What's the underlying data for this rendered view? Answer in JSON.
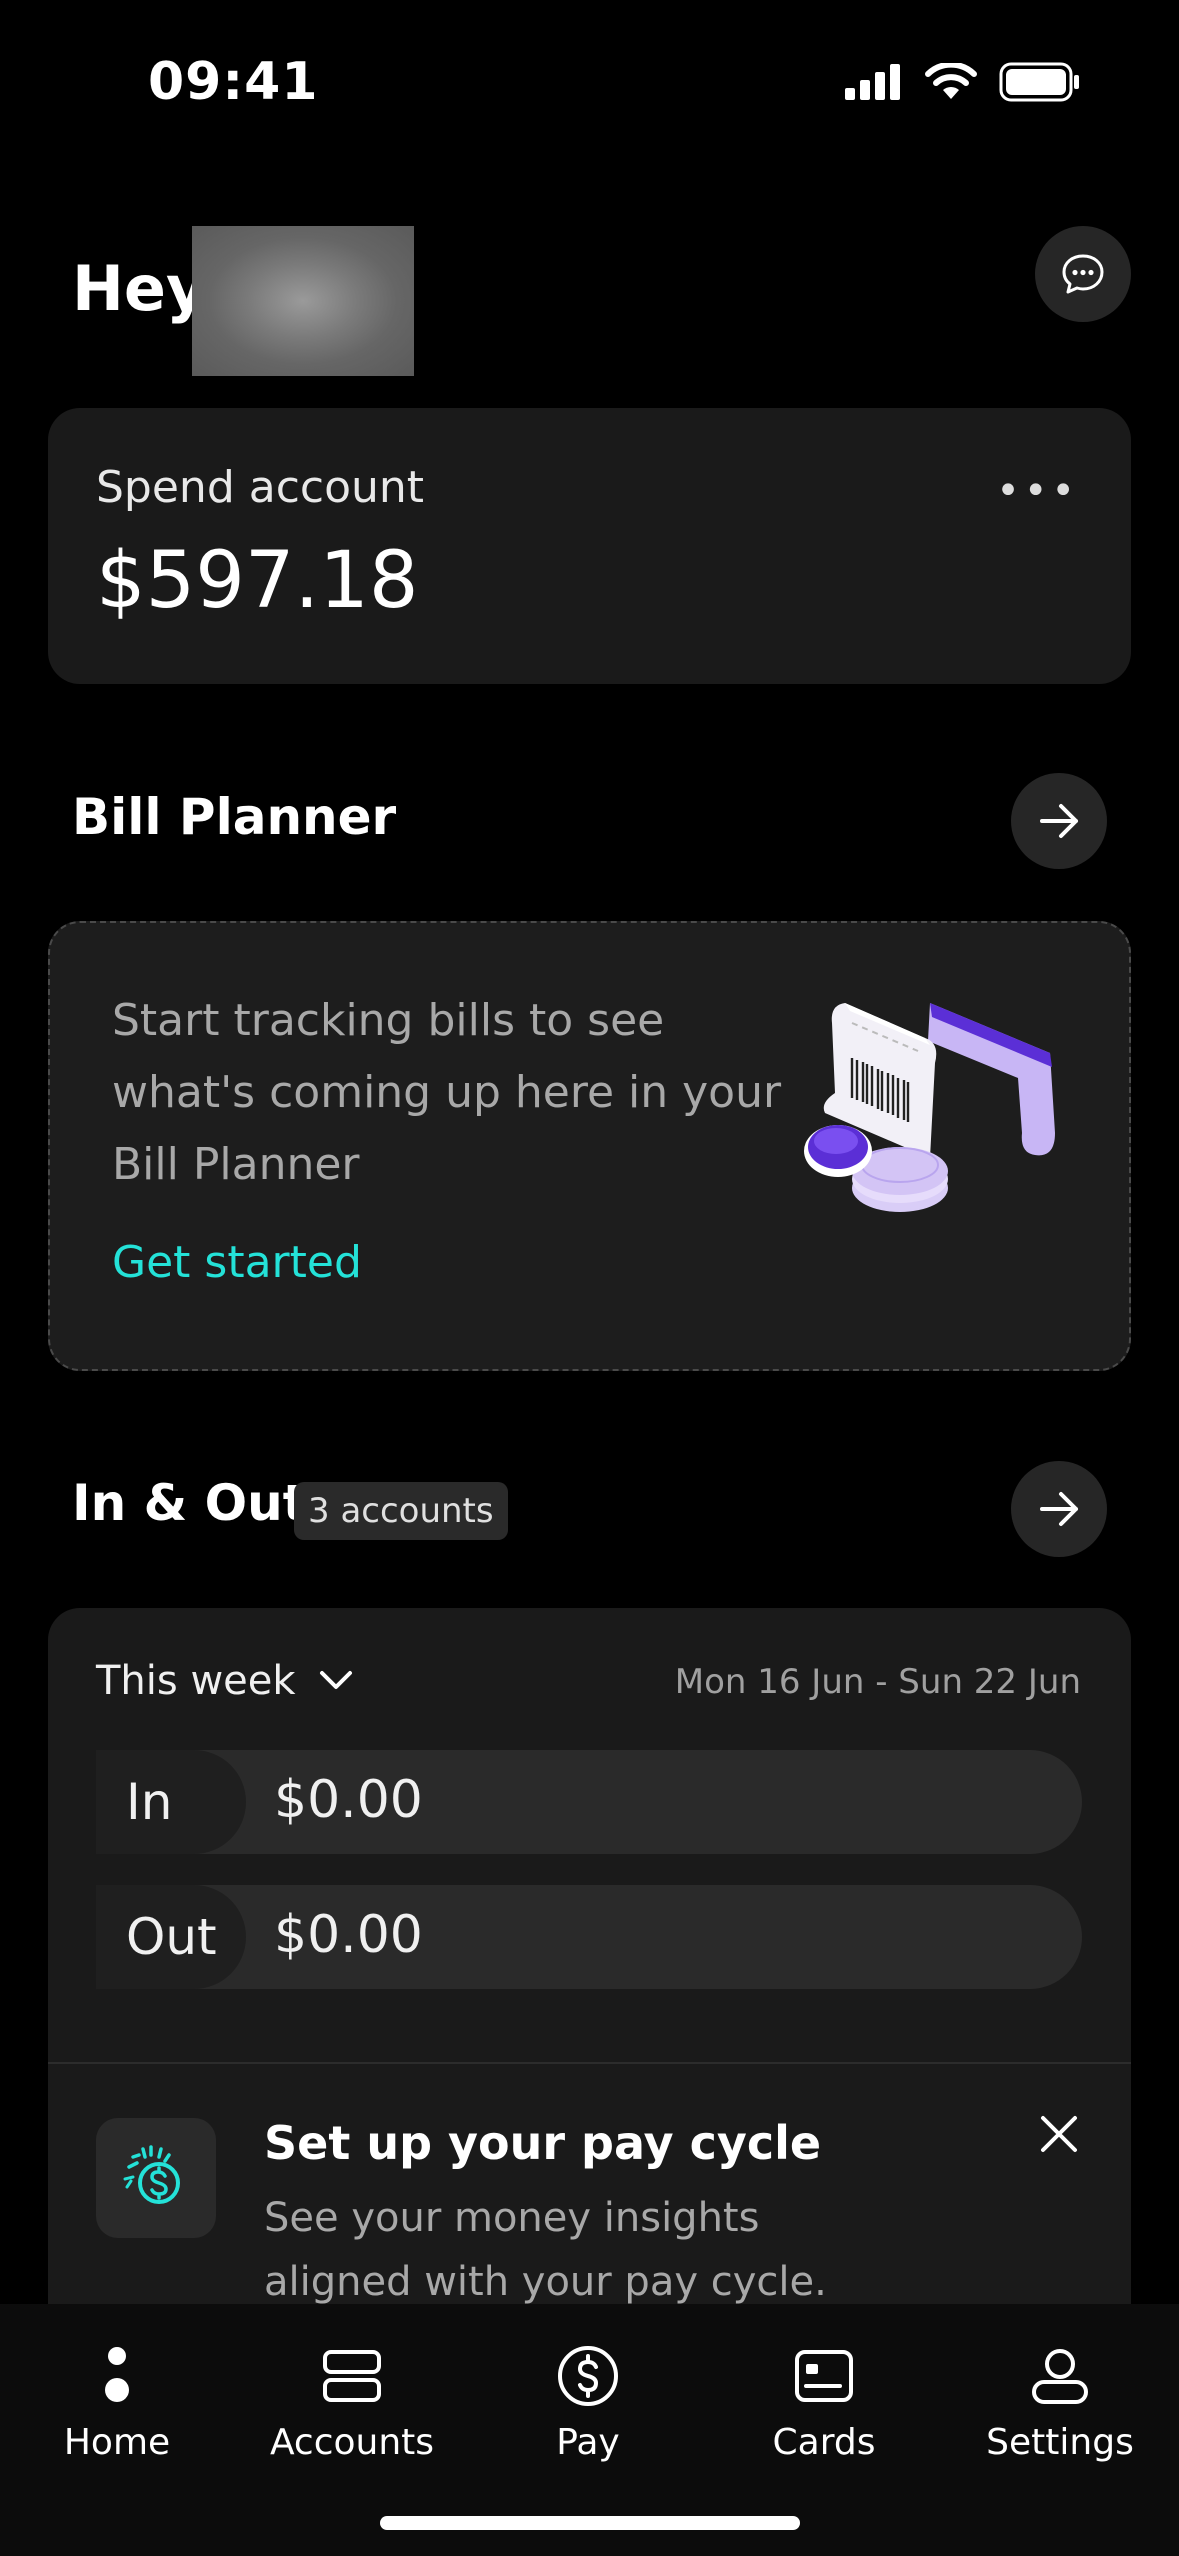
{
  "status_bar": {
    "time": "09:41"
  },
  "header": {
    "greeting": "Hey"
  },
  "spend_account": {
    "label": "Spend account",
    "balance": "$597.18"
  },
  "bill_planner": {
    "title": "Bill Planner",
    "message": "Start tracking bills to see what's coming up here in your Bill Planner",
    "cta": "Get started"
  },
  "in_out": {
    "title": "In & Out",
    "badge": "3 accounts",
    "period": "This week",
    "range": "Mon 16 Jun - Sun 22 Jun",
    "rows": [
      {
        "label": "In",
        "amount": "$0.00"
      },
      {
        "label": "Out",
        "amount": "$0.00"
      }
    ]
  },
  "pay_cycle": {
    "title": "Set up your pay cycle",
    "description": "See your money insights aligned with your pay cycle."
  },
  "tabs": [
    {
      "label": "Home",
      "icon": "home-dot-icon"
    },
    {
      "label": "Accounts",
      "icon": "accounts-icon"
    },
    {
      "label": "Pay",
      "icon": "dollar-circle-icon"
    },
    {
      "label": "Cards",
      "icon": "card-icon"
    },
    {
      "label": "Settings",
      "icon": "person-icon"
    }
  ],
  "colors": {
    "accent": "#24e2d8",
    "purple": "#5b2fd6",
    "lavender": "#c8b6f5"
  }
}
